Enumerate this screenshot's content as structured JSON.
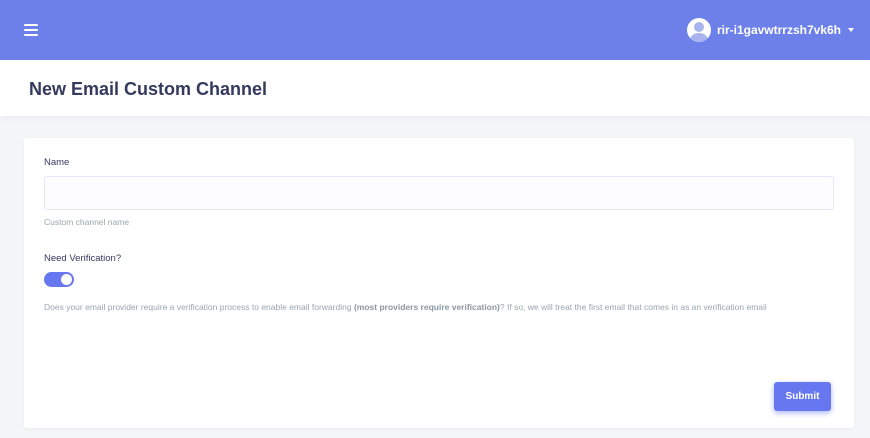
{
  "topbar": {
    "menu_icon": "hamburger-icon",
    "user": {
      "avatar_icon": "user-avatar-icon",
      "username": "rir-i1gavwtrrzsh7vk6h",
      "dropdown_icon": "caret-down-icon"
    },
    "color": "#6d7fe8"
  },
  "page": {
    "title": "New Email Custom Channel"
  },
  "form": {
    "name": {
      "label": "Name",
      "value": "",
      "placeholder": "",
      "hint": "Custom channel name"
    },
    "verification": {
      "label": "Need Verification?",
      "enabled": true,
      "hint_before": "Does your email provider require a verification process to enable email forwarding ",
      "hint_bold": "(most providers require verification)",
      "hint_after": "? If so, we will treat the first email that comes in as an verification email"
    },
    "submit_label": "Submit",
    "accent_color": "#6777ef"
  }
}
